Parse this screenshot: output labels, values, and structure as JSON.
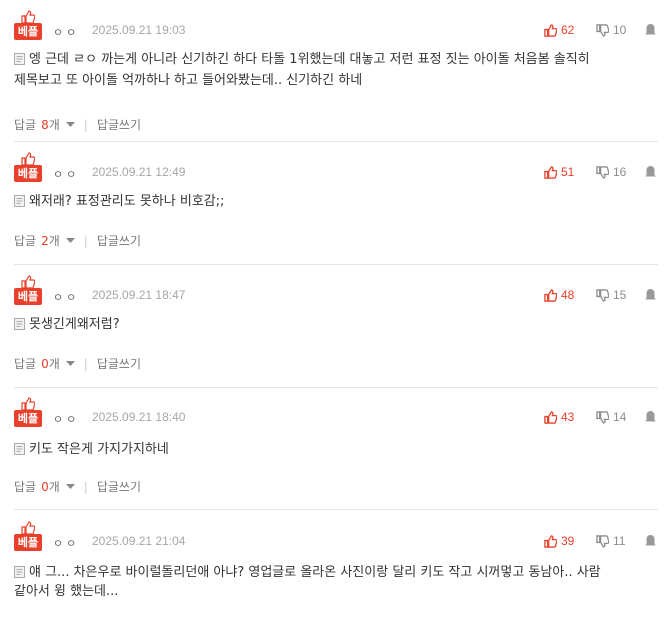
{
  "comments": [
    {
      "badge": "베플",
      "author": "ㅇㅇ",
      "date": "2025.09.21 19:03",
      "up": "62",
      "down": "10",
      "lines": [
        "엥 근데 ㄹㅇ 까는게 아니라 신기하긴 하다 타돌 1위했는데 대놓고 저런 표정 짓는 아이돌 처음봄 솔직히",
        "제목보고 또 아이돌 억까하나 하고 들어와봤는데.. 신기하긴 하네"
      ],
      "reply_label": "답글",
      "reply_count": "8",
      "reply_unit": "개",
      "write_reply": "답글쓰기"
    },
    {
      "badge": "베플",
      "author": "ㅇㅇ",
      "date": "2025.09.21 12:49",
      "up": "51",
      "down": "16",
      "lines": [
        "왜저래? 표정관리도 못하나 비호감;;"
      ],
      "reply_label": "답글",
      "reply_count": "2",
      "reply_unit": "개",
      "write_reply": "답글쓰기"
    },
    {
      "badge": "베플",
      "author": "ㅇㅇ",
      "date": "2025.09.21 18:47",
      "up": "48",
      "down": "15",
      "lines": [
        "못생긴게왜저럼?"
      ],
      "reply_label": "답글",
      "reply_count": "0",
      "reply_unit": "개",
      "write_reply": "답글쓰기"
    },
    {
      "badge": "베플",
      "author": "ㅇㅇ",
      "date": "2025.09.21 18:40",
      "up": "43",
      "down": "14",
      "lines": [
        "키도 작은게 가지가지하네"
      ],
      "reply_label": "답글",
      "reply_count": "0",
      "reply_unit": "개",
      "write_reply": "답글쓰기"
    },
    {
      "badge": "베플",
      "author": "ㅇㅇ",
      "date": "2025.09.21 21:04",
      "up": "39",
      "down": "11",
      "lines": [
        "얘 그... 차은우로 바이럴돌리던애 아냐? 영업글로 올라온 사진이랑 달리 키도 작고 시꺼멓고 동남아.. 사람",
        "같아서 윙 했는데..."
      ]
    }
  ],
  "icons": {
    "up": "thumbs-up-icon",
    "down": "thumbs-down-icon",
    "report": "report-icon",
    "doc": "document-icon",
    "caret": "caret-down-icon"
  },
  "colors": {
    "accent": "#e8402a",
    "muted": "#8c8c8c",
    "divider": "#e6e6e6"
  }
}
